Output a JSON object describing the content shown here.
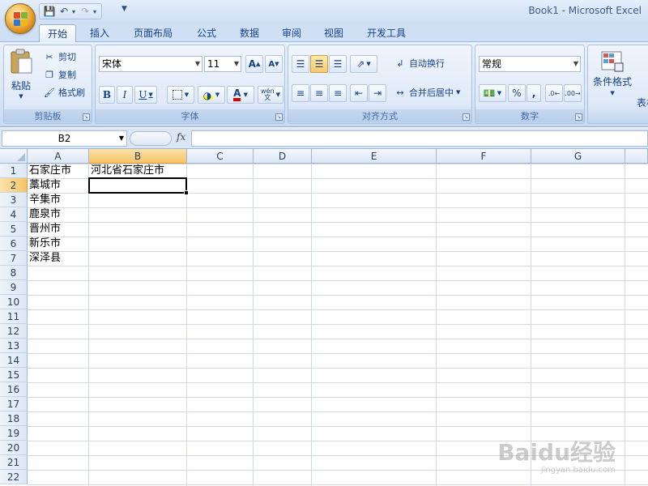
{
  "title_bar": {
    "app_title": "Book1 - Microsoft Excel"
  },
  "tabs": [
    "开始",
    "插入",
    "页面布局",
    "公式",
    "数据",
    "审阅",
    "视图",
    "开发工具"
  ],
  "active_tab": "开始",
  "ribbon": {
    "clipboard": {
      "label": "剪贴板",
      "paste": "粘贴",
      "cut": "剪切",
      "copy": "复制",
      "format_painter": "格式刷"
    },
    "font": {
      "label": "字体",
      "font_name": "宋体",
      "font_size": "11",
      "grow": "A",
      "shrink": "A",
      "bold": "B",
      "italic": "I",
      "underline": "U",
      "phonetic": "wén"
    },
    "alignment": {
      "label": "对齐方式",
      "wrap_text": "自动换行",
      "merge_center": "合并后居中"
    },
    "number": {
      "label": "数字",
      "format": "常规",
      "percent": "%",
      "comma": ","
    },
    "styles": {
      "conditional_format": "条件格式",
      "table": "表格"
    }
  },
  "formula_bar": {
    "name_box": "B2",
    "fx": "fx",
    "formula": ""
  },
  "columns": [
    "A",
    "B",
    "C",
    "D",
    "E",
    "F",
    "G"
  ],
  "selected_column": "B",
  "rows": [
    "1",
    "2",
    "3",
    "4",
    "5",
    "6",
    "7",
    "8",
    "9",
    "10",
    "11",
    "12",
    "13",
    "14",
    "15",
    "16",
    "17",
    "18",
    "19",
    "20",
    "21",
    "22"
  ],
  "selected_row": "2",
  "cells": {
    "A1": "石家庄市",
    "B1": "河北省石家庄市",
    "A2": "藁城市",
    "A3": "辛集市",
    "A4": "鹿泉市",
    "A5": "晋州市",
    "A6": "新乐市",
    "A7": "深泽县"
  },
  "watermark": {
    "main": "Baidu经验",
    "sub": "jingyan.baidu.com"
  }
}
